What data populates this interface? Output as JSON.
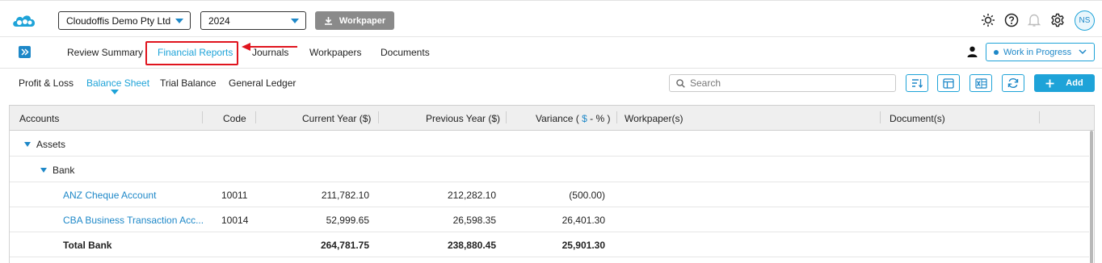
{
  "topbar": {
    "company": "Cloudoffis Demo Pty Ltd",
    "year": "2024",
    "workpaper_label": "Workpaper",
    "avatar_initials": "NS"
  },
  "nav": {
    "tabs": [
      "Review Summary",
      "Financial Reports",
      "Journals",
      "Workpapers",
      "Documents"
    ],
    "active_tab": "Financial Reports",
    "status": "Work in Progress"
  },
  "subnav": {
    "tabs": [
      "Profit & Loss",
      "Balance Sheet",
      "Trial Balance",
      "General Ledger"
    ],
    "active_tab": "Balance Sheet",
    "search_placeholder": "Search",
    "add_label": "Add"
  },
  "table": {
    "headers": {
      "accounts": "Accounts",
      "code": "Code",
      "current_year": "Current Year ($)",
      "previous_year": "Previous Year ($)",
      "variance_prefix": "Variance (",
      "variance_dollar": "$",
      "variance_sep": " - ",
      "variance_pct": "%",
      "variance_suffix": " )",
      "workpapers": "Workpaper(s)",
      "documents": "Document(s)"
    },
    "group": "Assets",
    "subgroup": "Bank",
    "rows": [
      {
        "account": "ANZ Cheque Account",
        "code": "10011",
        "current": "211,782.10",
        "previous": "212,282.10",
        "variance": "(500.00)"
      },
      {
        "account": "CBA Business Transaction Acc...",
        "code": "10014",
        "current": "52,999.65",
        "previous": "26,598.35",
        "variance": "26,401.30"
      }
    ],
    "total": {
      "label": "Total Bank",
      "current": "264,781.75",
      "previous": "238,880.45",
      "variance": "25,901.30"
    }
  },
  "colors": {
    "accent": "#1ea3d8",
    "link": "#1e88c8",
    "highlight": "#e0141e"
  }
}
